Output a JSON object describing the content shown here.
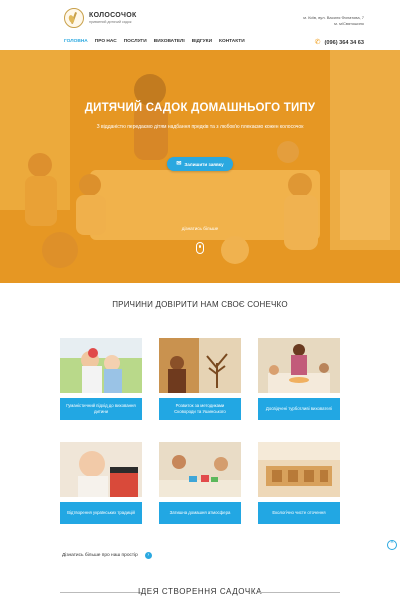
{
  "header": {
    "logo_name": "КОЛОСОЧОК",
    "logo_sub": "приватний дитячий садок",
    "address_line1": "м. Київ, вул. Василя Филатова, 7",
    "address_line2": "м. м/Святошино",
    "phone": "(096) 364 34 63",
    "phone_icon": "phone-icon"
  },
  "nav": {
    "items": [
      {
        "label": "ГОЛОВНА",
        "active": true
      },
      {
        "label": "ПРО НАС",
        "active": false
      },
      {
        "label": "ПОСЛУГИ",
        "active": false
      },
      {
        "label": "ВИХОВАТЕЛІ",
        "active": false
      },
      {
        "label": "ВІДГУКИ",
        "active": false
      },
      {
        "label": "КОНТАКТИ",
        "active": false
      }
    ]
  },
  "hero": {
    "title": "ДИТЯЧИЙ САДОК ДОМАШНЬОГО ТИПУ",
    "subtitle": "З відданістю передаємо дітям надбання предків та з любов'ю плекаємо кожен колосочок",
    "cta_label": "Залишити заявку",
    "more_label": "дізнатись більше"
  },
  "reasons": {
    "title": "ПРИЧИНИ ДОВІРИТИ НАМ СВОЄ СОНЕЧКО",
    "cards": [
      {
        "caption": "Гуманістичний підхід до виховання дитини"
      },
      {
        "caption": "Розвиток за методиками Сковороди та Ушинського"
      },
      {
        "caption": "Досвідчені турботливі вихователі"
      },
      {
        "caption": "Відтворення українських традицій"
      },
      {
        "caption": "Затишна домашня атмосфера"
      },
      {
        "caption": "Екологічно чисте оточення"
      }
    ]
  },
  "explore_label": "Дізнатись більше про наш простір",
  "bottom_title": "ІДЕЯ СТВОРЕННЯ САДОЧКА",
  "colors": {
    "accent": "#2aa8e0",
    "hero_overlay": "#f0a324"
  }
}
